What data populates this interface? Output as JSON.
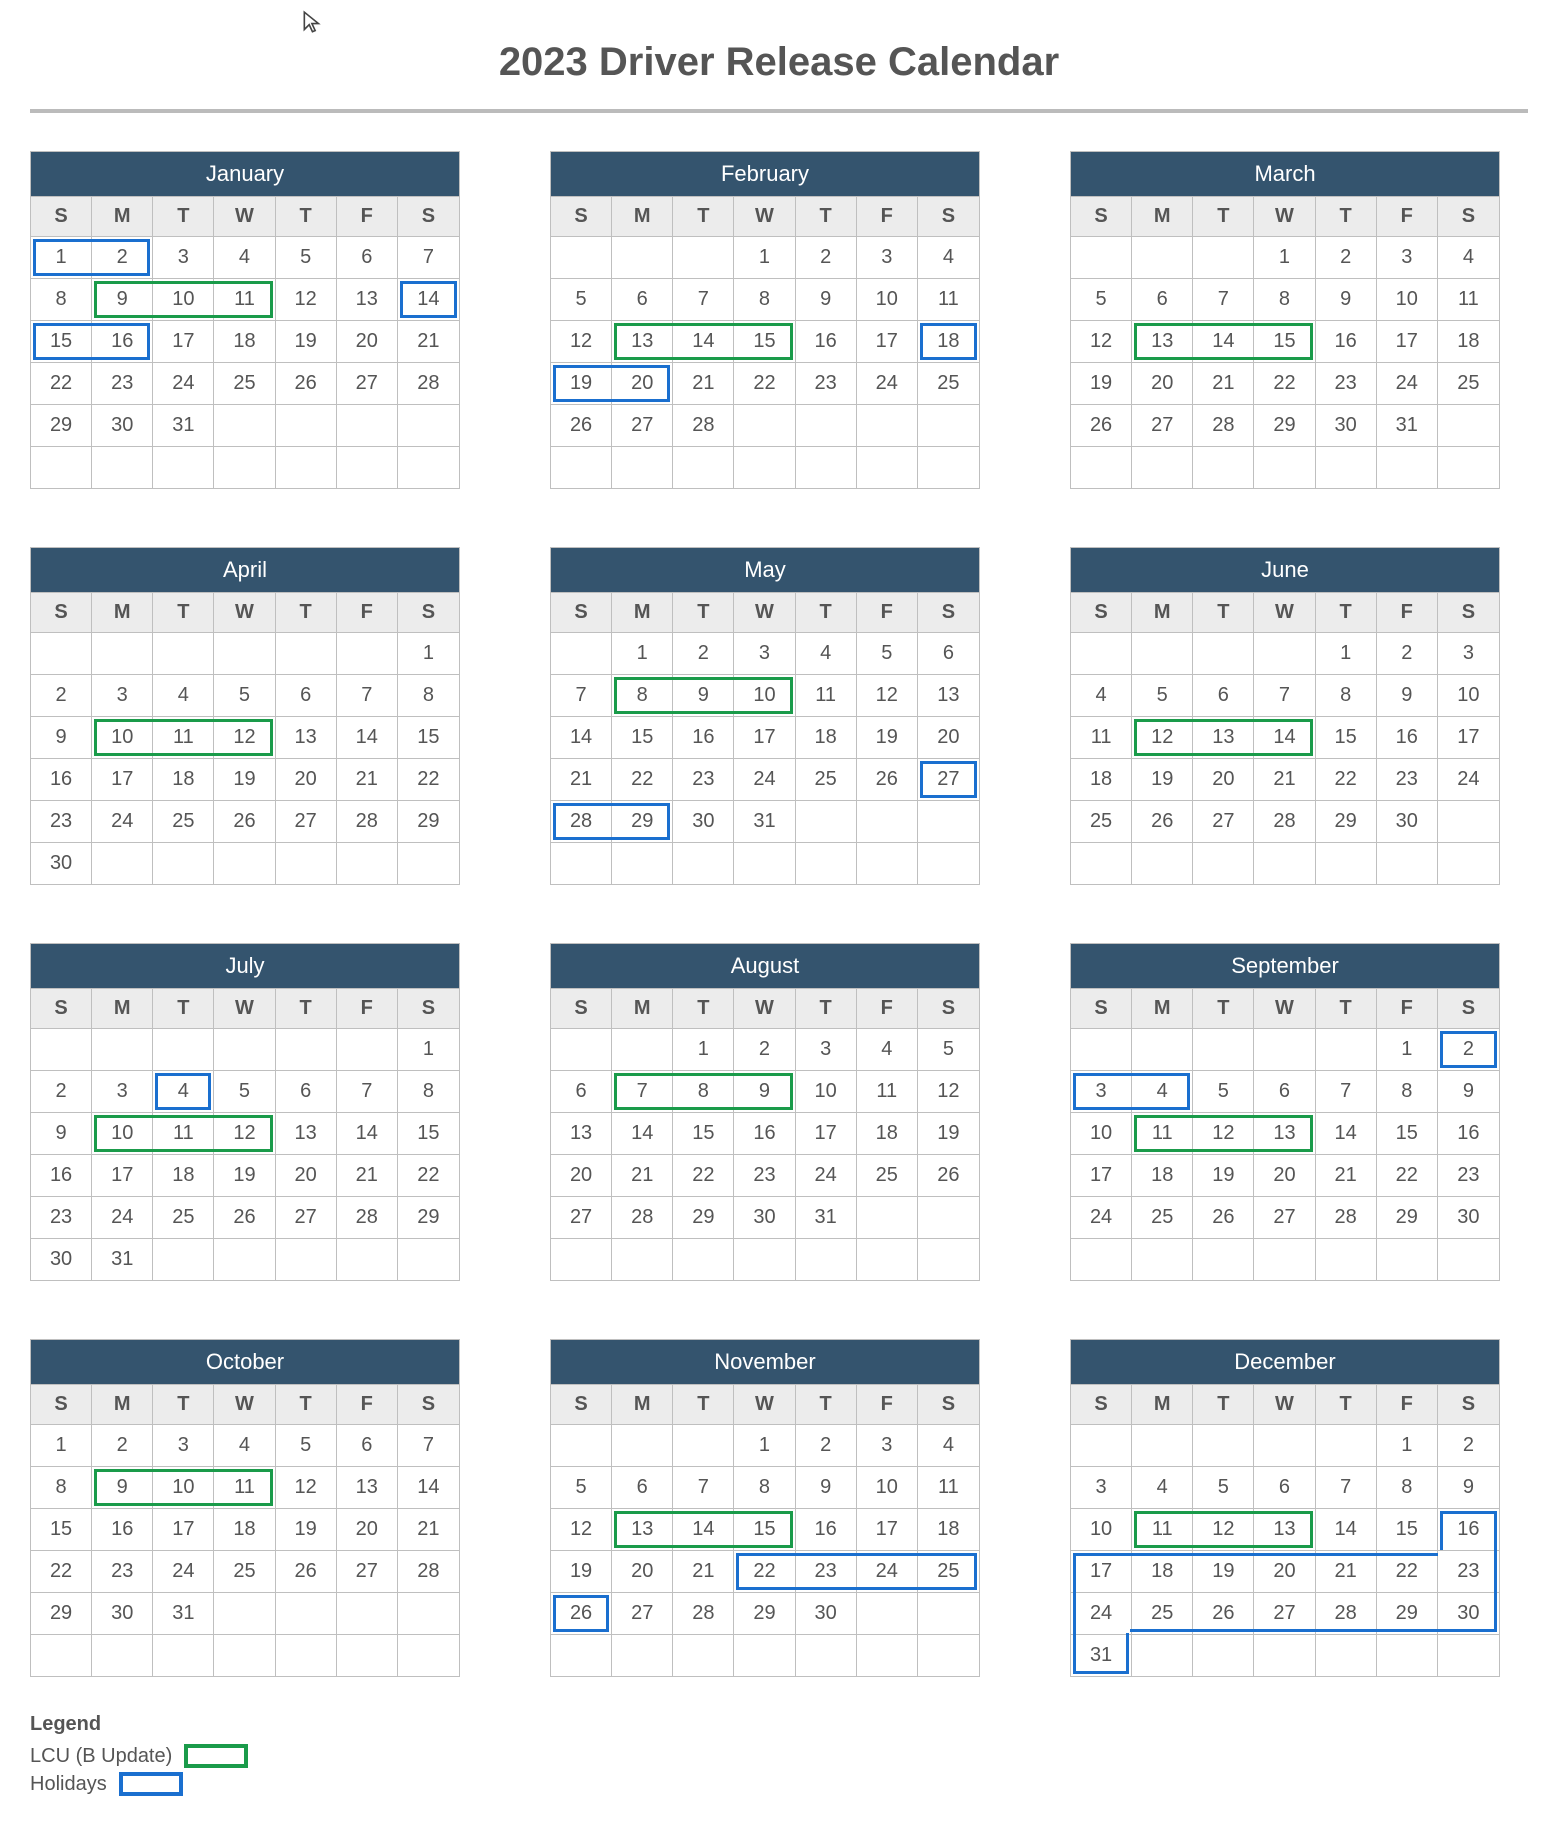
{
  "title": "2023 Driver Release Calendar",
  "year": 2023,
  "dow": [
    "S",
    "M",
    "T",
    "W",
    "T",
    "F",
    "S"
  ],
  "legend": {
    "title": "Legend",
    "lcu": "LCU (B Update)",
    "holidays": "Holidays"
  },
  "colors": {
    "headerBg": "#34546e",
    "lcu": "#1a9b4a",
    "holiday": "#1a6fcf"
  },
  "months": [
    {
      "name": "January",
      "startDow": 0,
      "days": 31,
      "lcu": [
        9,
        10,
        11
      ],
      "holidays": [
        1,
        2,
        14,
        15,
        16
      ]
    },
    {
      "name": "February",
      "startDow": 3,
      "days": 28,
      "lcu": [
        13,
        14,
        15
      ],
      "holidays": [
        18,
        19,
        20
      ]
    },
    {
      "name": "March",
      "startDow": 3,
      "days": 31,
      "lcu": [
        13,
        14,
        15
      ],
      "holidays": []
    },
    {
      "name": "April",
      "startDow": 6,
      "days": 30,
      "lcu": [
        10,
        11,
        12
      ],
      "holidays": []
    },
    {
      "name": "May",
      "startDow": 1,
      "days": 31,
      "lcu": [
        8,
        9,
        10
      ],
      "holidays": [
        27,
        28,
        29
      ]
    },
    {
      "name": "June",
      "startDow": 4,
      "days": 30,
      "lcu": [
        12,
        13,
        14
      ],
      "holidays": []
    },
    {
      "name": "July",
      "startDow": 6,
      "days": 31,
      "lcu": [
        10,
        11,
        12
      ],
      "holidays": [
        4
      ]
    },
    {
      "name": "August",
      "startDow": 2,
      "days": 31,
      "lcu": [
        7,
        8,
        9
      ],
      "holidays": []
    },
    {
      "name": "September",
      "startDow": 5,
      "days": 30,
      "lcu": [
        11,
        12,
        13
      ],
      "holidays": [
        2,
        3,
        4
      ]
    },
    {
      "name": "October",
      "startDow": 0,
      "days": 31,
      "lcu": [
        9,
        10,
        11
      ],
      "holidays": []
    },
    {
      "name": "November",
      "startDow": 3,
      "days": 30,
      "lcu": [
        13,
        14,
        15
      ],
      "holidays": [
        22,
        23,
        24,
        25,
        26
      ]
    },
    {
      "name": "December",
      "startDow": 5,
      "days": 31,
      "lcu": [
        11,
        12,
        13
      ],
      "holidays": [
        16,
        17,
        18,
        19,
        20,
        21,
        22,
        23,
        24,
        25,
        26,
        27,
        28,
        29,
        30,
        31
      ]
    }
  ]
}
